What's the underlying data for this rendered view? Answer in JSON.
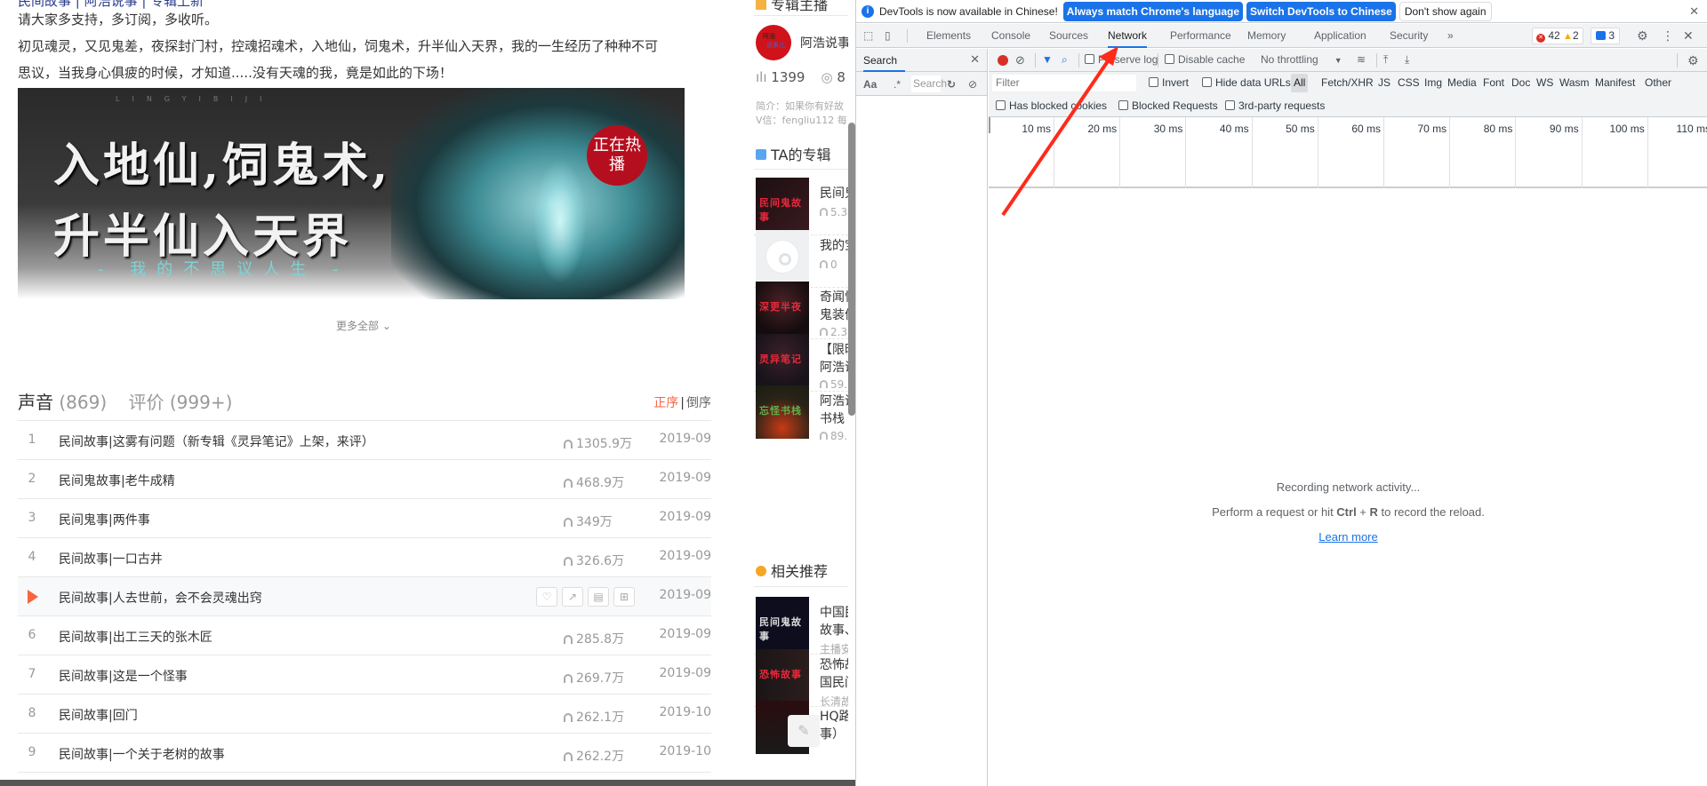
{
  "page": {
    "intro_cut": "民间故事 | 阿浩说事 | 专辑上新",
    "intro_line1": "请大家多支持，多订阅，多收听。",
    "intro_line2": "初见魂灵，又见鬼差，夜探封门村，控魂招魂术，入地仙，饲鬼术，升半仙入天界，我的一生经历了种种不可",
    "intro_line3": "思议，当我身心俱疲的时候，才知道.....没有天魂的我，竟是如此的下场！",
    "banner": {
      "latin": "LINGYIBIJI",
      "title1": "入地仙,饲鬼术,",
      "title2": "升半仙入天界",
      "subtitle": "- 我的不思议人生 -",
      "badge": "正在热播"
    },
    "more_label": "更多全部",
    "tabs": {
      "sounds_label": "声音",
      "sounds_count": "(869)",
      "reviews_label": "评价",
      "reviews_count": "(999+)"
    },
    "sort": {
      "asc": "正序",
      "sep": "|",
      "desc": "倒序",
      "active": "asc"
    },
    "tracks": [
      {
        "num": "1",
        "title": "民间故事|这雾有问题（新专辑《灵异笔记》上架，来评）",
        "plays": "1305.9万",
        "date": "2019-09"
      },
      {
        "num": "2",
        "title": "民间鬼故事|老牛成精",
        "plays": "468.9万",
        "date": "2019-09"
      },
      {
        "num": "3",
        "title": "民间鬼事|两件事",
        "plays": "349万",
        "date": "2019-09"
      },
      {
        "num": "4",
        "title": "民间故事|一口古井",
        "plays": "326.6万",
        "date": "2019-09"
      },
      {
        "num": "5",
        "title": "民间故事|人去世前，会不会灵魂出窍",
        "plays": "",
        "date": "2019-09",
        "playing": true
      },
      {
        "num": "6",
        "title": "民间故事|出工三天的张木匠",
        "plays": "285.8万",
        "date": "2019-09"
      },
      {
        "num": "7",
        "title": "民间故事|这是一个怪事",
        "plays": "269.7万",
        "date": "2019-09"
      },
      {
        "num": "8",
        "title": "民间故事|回门",
        "plays": "262.1万",
        "date": "2019-10"
      },
      {
        "num": "9",
        "title": "民间故事|一个关于老树的故事",
        "plays": "262.2万",
        "date": "2019-10"
      }
    ],
    "row_actions": [
      "like",
      "share",
      "comment",
      "add"
    ]
  },
  "sidebar": {
    "anchor_heading": "专辑主播",
    "avatar_text1": "阿浩",
    "avatar_text2": "说事儿",
    "anchor_name": "阿浩说事",
    "tracks_count": "1399",
    "followers": "8",
    "bio1": "简介：如果你有好故",
    "bio2": "V信：fengliu112 每",
    "albums_heading": "TA的专辑",
    "albums": [
      {
        "name": "民间鬼",
        "name2": "",
        "plays": "5.3",
        "cover_text": "民间鬼故事"
      },
      {
        "name": "我的宝",
        "name2": "",
        "plays": "0",
        "cover_text": ""
      },
      {
        "name": "奇闻怪",
        "name2": "鬼装傀",
        "plays": "2.3",
        "cover_text": "深更半夜"
      },
      {
        "name": "【限时",
        "name2": "阿浩说",
        "plays": "59.",
        "cover_text": "灵异笔记"
      },
      {
        "name": "阿浩说",
        "name2": "书栈",
        "plays": "89.",
        "cover_text": "忘怪书栈"
      }
    ],
    "related_heading": "相关推荐",
    "related": [
      {
        "name": "中国民",
        "name2": "故事、",
        "meta": "主播安",
        "cover_text": "民间鬼故事"
      },
      {
        "name": "恐怖故",
        "name2": "国民间",
        "meta": "长清故",
        "cover_text": "恐怖故事"
      },
      {
        "name": "HQ路",
        "name2": "事）",
        "meta": "",
        "cover_text": ""
      }
    ]
  },
  "devtools": {
    "infobar": {
      "message": "DevTools is now available in Chinese!",
      "btn_match": "Always match Chrome's language",
      "btn_switch": "Switch DevTools to Chinese",
      "btn_dismiss": "Don't show again"
    },
    "tabs": [
      "Elements",
      "Console",
      "Sources",
      "Network",
      "Performance",
      "Memory",
      "Application",
      "Security"
    ],
    "active_tab": "Network",
    "more_tabs": "»",
    "errors": "42",
    "warnings": "2",
    "messages": "3",
    "search": {
      "title": "Search",
      "case_label": "Aa",
      "regex_label": ".*",
      "placeholder": "Search"
    },
    "toolbar": {
      "preserve_log": "Preserve log",
      "disable_cache": "Disable cache",
      "throttling": "No throttling"
    },
    "filter": {
      "placeholder": "Filter",
      "invert": "Invert",
      "hide_data_urls": "Hide data URLs",
      "types": [
        "All",
        "Fetch/XHR",
        "JS",
        "CSS",
        "Img",
        "Media",
        "Font",
        "Doc",
        "WS",
        "Wasm",
        "Manifest",
        "Other"
      ],
      "active_type": "All",
      "blocked_cookies": "Has blocked cookies",
      "blocked_requests": "Blocked Requests",
      "third_party": "3rd-party requests"
    },
    "timeline_ticks": [
      "10 ms",
      "20 ms",
      "30 ms",
      "40 ms",
      "50 ms",
      "60 ms",
      "70 ms",
      "80 ms",
      "90 ms",
      "100 ms",
      "110 ms"
    ],
    "empty": {
      "line1": "Recording network activity...",
      "line2_pre": "Perform a request or hit ",
      "line2_key1": "Ctrl",
      "line2_plus": " + ",
      "line2_key2": "R",
      "line2_post": " to record the reload.",
      "learn_more": "Learn more"
    }
  },
  "annotation": {
    "color": "#ff2a1a"
  }
}
